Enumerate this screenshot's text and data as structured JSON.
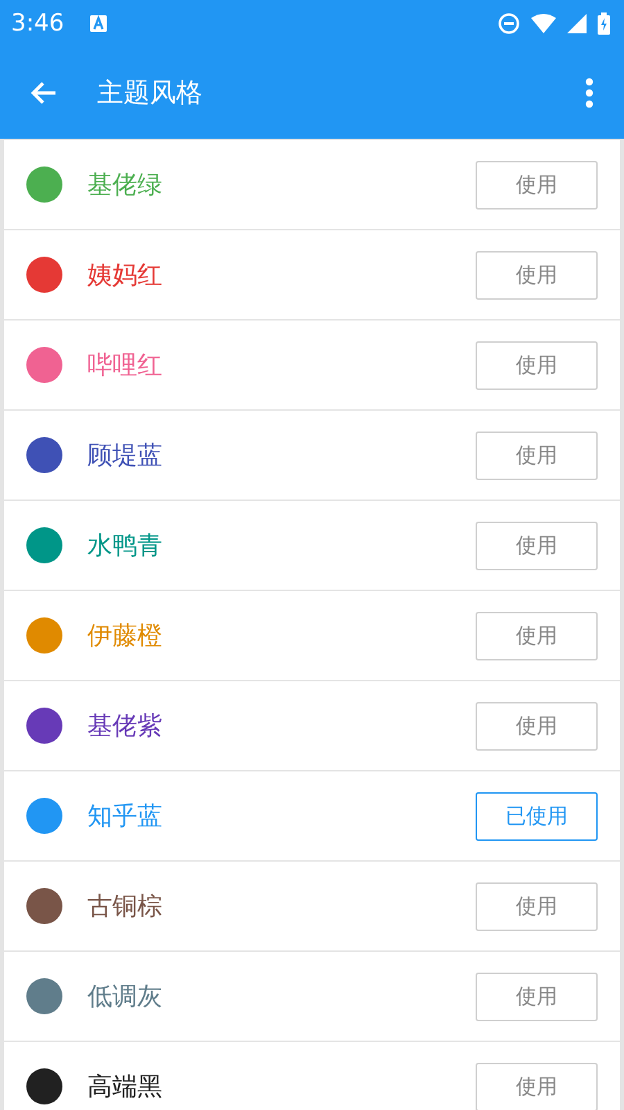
{
  "status_bar": {
    "time": "3:46"
  },
  "app_bar": {
    "title": "主题风格"
  },
  "themes": [
    {
      "name": "基佬绿",
      "color": "#4caf50",
      "button": "使用",
      "selected": false
    },
    {
      "name": "姨妈红",
      "color": "#e53935",
      "button": "使用",
      "selected": false
    },
    {
      "name": "哔哩红",
      "color": "#f06292",
      "button": "使用",
      "selected": false
    },
    {
      "name": "顾堤蓝",
      "color": "#3f51b5",
      "button": "使用",
      "selected": false
    },
    {
      "name": "水鸭青",
      "color": "#009688",
      "button": "使用",
      "selected": false
    },
    {
      "name": "伊藤橙",
      "color": "#e08a00",
      "button": "使用",
      "selected": false
    },
    {
      "name": "基佬紫",
      "color": "#673ab7",
      "button": "使用",
      "selected": false
    },
    {
      "name": "知乎蓝",
      "color": "#2196f3",
      "button": "已使用",
      "selected": true
    },
    {
      "name": "古铜棕",
      "color": "#795548",
      "button": "使用",
      "selected": false
    },
    {
      "name": "低调灰",
      "color": "#607d8b",
      "button": "使用",
      "selected": false
    },
    {
      "name": "高端黑",
      "color": "#212121",
      "button": "使用",
      "selected": false
    }
  ]
}
